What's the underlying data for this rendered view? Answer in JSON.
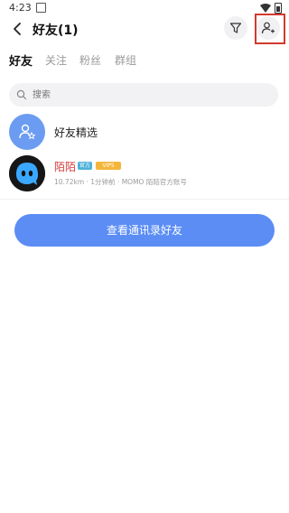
{
  "status_bar": {
    "time": "4:23"
  },
  "header": {
    "title": "好友(1)"
  },
  "tabs": [
    {
      "label": "好友",
      "active": true
    },
    {
      "label": "关注",
      "active": false
    },
    {
      "label": "粉丝",
      "active": false
    },
    {
      "label": "群组",
      "active": false
    }
  ],
  "search": {
    "placeholder": "搜索"
  },
  "list": {
    "featured": {
      "label": "好友精选"
    },
    "friend": {
      "name": "陌陌",
      "badge_official": "官方",
      "badge_vip": "VIP5",
      "subtitle": "10.72km · 1分钟前 · MOMO 陌陌官方账号"
    }
  },
  "contacts_button": {
    "label": "查看通讯录好友"
  },
  "colors": {
    "accent": "#5b8df5",
    "featured_avatar": "#6b9cf1",
    "name_red": "#d33b3b",
    "highlight_red": "#d23a2f"
  }
}
